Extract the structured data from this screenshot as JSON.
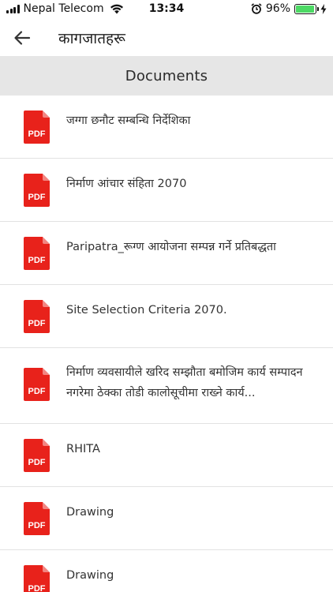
{
  "status_bar": {
    "carrier": "Nepal Telecom",
    "time": "13:34",
    "battery": "96%",
    "battery_level": 0.96,
    "battery_color": "#4cd964"
  },
  "header": {
    "title": "कागजातहरू",
    "back_icon": "arrow-left-icon"
  },
  "section": {
    "title": "Documents"
  },
  "pdf_icon": {
    "label": "PDF",
    "color": "#e8221b"
  },
  "documents": [
    {
      "title": "जग्गा छनौट सम्बन्धि निर्देशिका"
    },
    {
      "title": "निर्माण आंचार संहिता 2070"
    },
    {
      "title": "Paripatra_रूग्ण आयोजना सम्पन्न गर्ने प्रतिबद्धता"
    },
    {
      "title": "Site Selection Criteria 2070."
    },
    {
      "title": "निर्माण व्यवसायीले खरिद सम्झौता बमोजिम कार्य सम्पादन नगरेमा ठेक्का तोडी कालोसूचीमा राख्ने कार्य..."
    },
    {
      "title": "RHITA"
    },
    {
      "title": "Drawing"
    },
    {
      "title": "Drawing"
    }
  ]
}
